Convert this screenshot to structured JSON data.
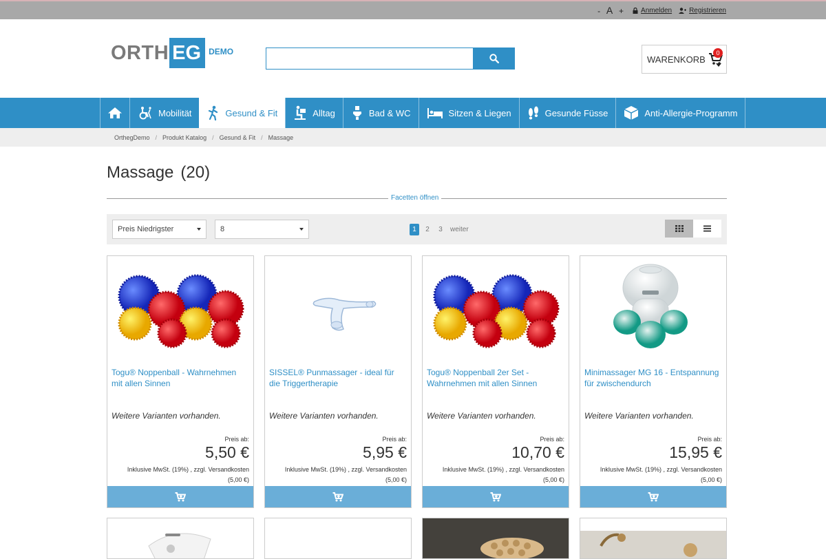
{
  "topbar": {
    "font_minus": "-",
    "font_label": "A",
    "font_plus": "+",
    "login": "Anmelden",
    "register": "Registrieren"
  },
  "header": {
    "logo_main": "ORTH",
    "logo_accent": "EG",
    "logo_demo": "DEMO",
    "search_value": "",
    "cart_label": "WARENKORB",
    "cart_count": "0"
  },
  "nav": {
    "items": [
      {
        "label": "Mobilität",
        "icon": "wheelchair-icon"
      },
      {
        "label": "Gesund & Fit",
        "icon": "walking-person-icon",
        "active": true
      },
      {
        "label": "Alltag",
        "icon": "reading-person-icon"
      },
      {
        "label": "Bad & WC",
        "icon": "toilet-icon"
      },
      {
        "label": "Sitzen & Liegen",
        "icon": "bed-icon"
      },
      {
        "label": "Gesunde Füsse",
        "icon": "footprints-icon"
      },
      {
        "label": "Anti-Allergie-Programm",
        "icon": "box-icon"
      }
    ]
  },
  "breadcrumb": [
    "OrthegDemo",
    "Produkt Katalog",
    "Gesund & Fit",
    "Massage"
  ],
  "page": {
    "title": "Massage",
    "count": "(20)",
    "facets": "Facetten öffnen"
  },
  "toolbar": {
    "sort_value": "Preis Niedrigster",
    "perpage_value": "8",
    "pages": [
      "1",
      "2",
      "3"
    ],
    "current_page": "1",
    "next": "weiter"
  },
  "products": [
    {
      "title": "Togu® Noppenball - Wahrnehmen mit allen Sinnen",
      "variants": "Weitere Varianten vorhanden.",
      "price_label": "Preis ab:",
      "price": "5,50 €",
      "tax": "Inklusive MwSt. (19%) , zzgl. Versandkosten",
      "shipping": "(5,00 €)"
    },
    {
      "title": "SISSEL® Punmassager - ideal für die Triggertherapie",
      "variants": "Weitere Varianten vorhanden.",
      "price_label": "Preis ab:",
      "price": "5,95 €",
      "tax": "Inklusive MwSt. (19%) , zzgl. Versandkosten",
      "shipping": "(5,00 €)"
    },
    {
      "title": "Togu® Noppenball 2er Set - Wahrnehmen mit allen Sinnen",
      "variants": "Weitere Varianten vorhanden.",
      "price_label": "Preis ab:",
      "price": "10,70 €",
      "tax": "Inklusive MwSt. (19%) , zzgl. Versandkosten",
      "shipping": "(5,00 €)"
    },
    {
      "title": "Minimassager MG 16 - Entspannung für zwischendurch",
      "variants": "Weitere Varianten vorhanden.",
      "price_label": "Preis ab:",
      "price": "15,95 €",
      "tax": "Inklusive MwSt. (19%) , zzgl. Versandkosten",
      "shipping": "(5,00 €)"
    }
  ],
  "colors": {
    "brand": "#2f8fc6",
    "add_to_cart": "#6aaed8",
    "badge": "#e02020"
  }
}
